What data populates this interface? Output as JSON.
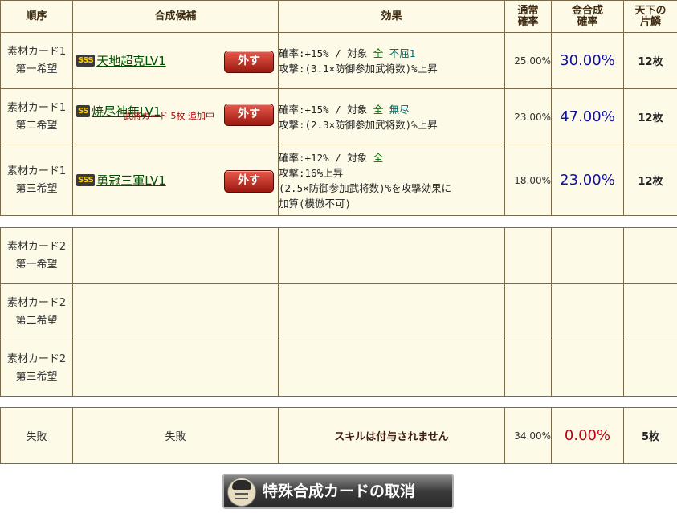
{
  "headers": {
    "order": "順序",
    "candidate": "合成候補",
    "effect": "効果",
    "normal_rate_1": "通常",
    "normal_rate_2": "確率",
    "gold_rate_1": "金合成",
    "gold_rate_2": "確率",
    "tenka_1": "天下の",
    "tenka_2": "片鱗"
  },
  "material1": [
    {
      "order_1": "素材カード1",
      "order_2": "第一希望",
      "rank": "SSS",
      "skill": "天地超克LV1",
      "remove": "外す",
      "effect_rate_label": "確率:+15% / 対象",
      "target_all": "全",
      "target_name": "不屈1",
      "effect_line2": "攻撃:(3.1×防御参加武将数)%上昇",
      "normal_rate": "25.00%",
      "gold_rate": "30.00%",
      "tenka": "12枚"
    },
    {
      "order_1": "素材カード1",
      "order_2": "第二希望",
      "rank": "SS",
      "skill": "焼尽神無LV1",
      "remove": "外す",
      "added_note": "武将カード 5枚 追加中",
      "effect_rate_label": "確率:+15% / 対象",
      "target_all": "全",
      "target_name": "無尽",
      "effect_line2": "攻撃:(2.3×防御参加武将数)%上昇",
      "normal_rate": "23.00%",
      "gold_rate": "47.00%",
      "tenka": "12枚"
    },
    {
      "order_1": "素材カード1",
      "order_2": "第三希望",
      "rank": "SSS",
      "skill": "勇冠三軍LV1",
      "remove": "外す",
      "effect_rate_label": "確率:+12% / 対象",
      "target_all": "全",
      "effect_line2": "攻撃:16%上昇",
      "effect_line3": "(2.5×防御参加武将数)%を攻撃効果に",
      "effect_line4": "加算(模倣不可)",
      "normal_rate": "18.00%",
      "gold_rate": "23.00%",
      "tenka": "12枚"
    }
  ],
  "material2": [
    {
      "order_1": "素材カード2",
      "order_2": "第一希望"
    },
    {
      "order_1": "素材カード2",
      "order_2": "第二希望"
    },
    {
      "order_1": "素材カード2",
      "order_2": "第三希望"
    }
  ],
  "failure": {
    "order": "失敗",
    "candidate": "失敗",
    "effect": "スキルは付与されません",
    "normal_rate": "34.00%",
    "gold_rate": "0.00%",
    "tenka": "5枚"
  },
  "cancel_button": "特殊合成カードの取消",
  "colors": {
    "table_bg": "#fdfbe8",
    "header_bg": "#ece8c2",
    "border": "#7a6a4a",
    "skill_link": "#005000",
    "gold_rate": "#1010a0",
    "fail_rate": "#c00010"
  }
}
